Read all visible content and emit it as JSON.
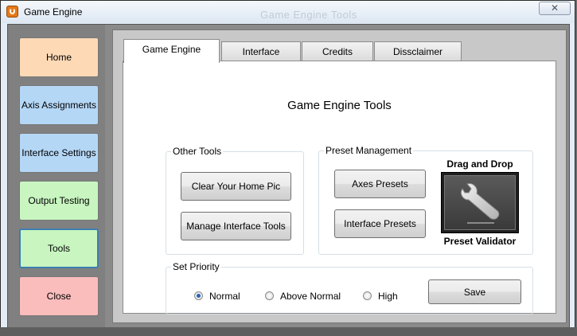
{
  "window": {
    "title": "Game Engine",
    "ghost_title": "Game Engine Tools",
    "close_glyph": "✕"
  },
  "sidebar": {
    "items": [
      {
        "label": "Home",
        "color": "#fdd9b5"
      },
      {
        "label": "Axis Assignments",
        "color": "#b5d7f6"
      },
      {
        "label": "Interface Settings",
        "color": "#b5d7f6"
      },
      {
        "label": "Output Testing",
        "color": "#c8f5c0"
      },
      {
        "label": "Tools",
        "color": "#c8f5c0"
      },
      {
        "label": "Close",
        "color": "#fbbcbc"
      }
    ]
  },
  "tabs": [
    "Game Engine",
    "Interface",
    "Credits",
    "Dissclaimer"
  ],
  "page": {
    "heading": "Game Engine Tools",
    "other_tools": {
      "label": "Other Tools",
      "clear_home_pic": "Clear Your Home Pic",
      "manage_interface_tools": "Manage Interface Tools"
    },
    "preset_management": {
      "label": "Preset Management",
      "axes_presets": "Axes Presets",
      "interface_presets": "Interface Presets",
      "drag_drop_label": "Drag and Drop",
      "validator_label": "Preset Validator"
    },
    "priority": {
      "label": "Set Priority",
      "options": [
        "Normal",
        "Above Normal",
        "High"
      ],
      "selected": "Normal",
      "save_label": "Save"
    }
  },
  "colors": {
    "accent": "#2a62b6",
    "selected_border": "#3c7fb1"
  }
}
